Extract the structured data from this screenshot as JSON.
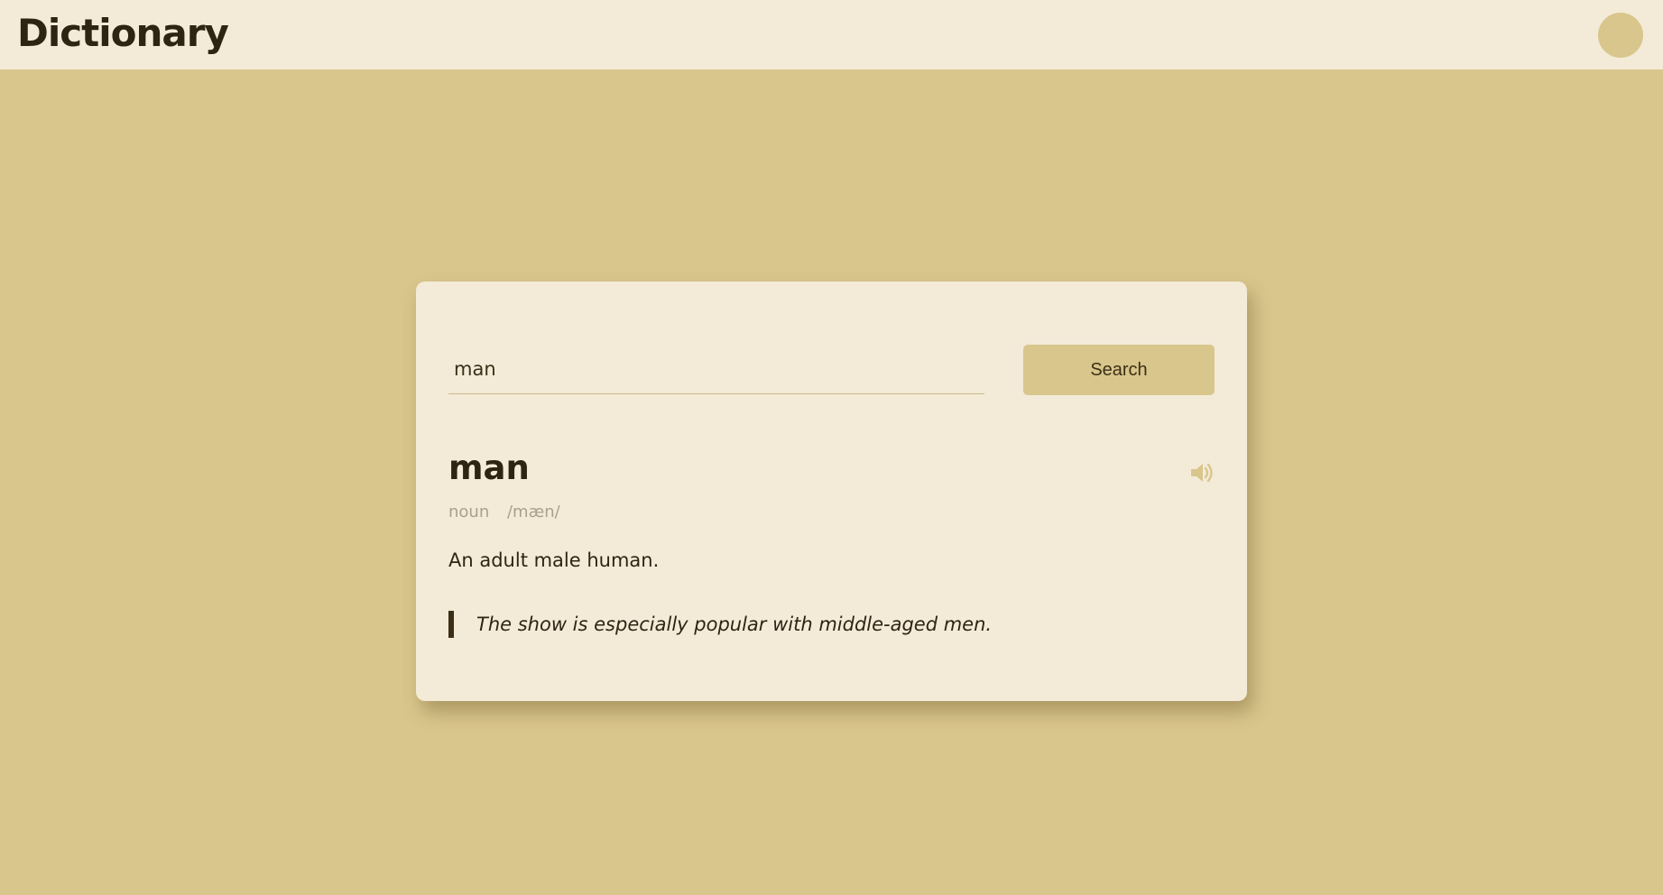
{
  "header": {
    "title": "Dictionary",
    "theme_toggle_icon": "circle-theme-toggle"
  },
  "search": {
    "value": "man",
    "placeholder": "",
    "button_label": "Search"
  },
  "result": {
    "word": "man",
    "part_of_speech": "noun",
    "phonetic": "/mæn/",
    "definition": "An adult male human.",
    "example": "The show is especially popular with middle-aged men.",
    "audio_icon": "speaker-icon"
  },
  "colors": {
    "background": "#d9c68c",
    "surface": "#f3ebd8",
    "text": "#2e2412",
    "muted": "#aaa08a"
  }
}
